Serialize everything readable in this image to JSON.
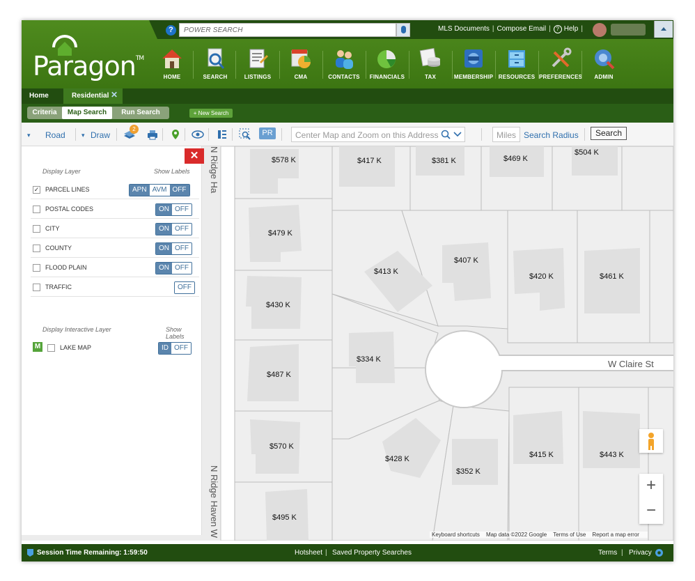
{
  "header": {
    "power_search_placeholder": "POWER SEARCH",
    "links": {
      "mls_documents": "MLS Documents",
      "compose_email": "Compose Email",
      "help": "Help"
    },
    "logo_text": "Paragon",
    "logo_tm": "TM",
    "nav": [
      {
        "label": "HOME",
        "icon": "home-icon"
      },
      {
        "label": "SEARCH",
        "icon": "search-icon"
      },
      {
        "label": "LISTINGS",
        "icon": "listings-icon"
      },
      {
        "label": "CMA",
        "icon": "cma-icon"
      },
      {
        "label": "CONTACTS",
        "icon": "contacts-icon"
      },
      {
        "label": "FINANCIALS",
        "icon": "financials-icon"
      },
      {
        "label": "TAX",
        "icon": "tax-icon"
      },
      {
        "label": "MEMBERSHIP",
        "icon": "membership-icon"
      },
      {
        "label": "RESOURCES",
        "icon": "resources-icon"
      },
      {
        "label": "PREFERENCES",
        "icon": "preferences-icon"
      },
      {
        "label": "ADMIN",
        "icon": "admin-icon"
      }
    ]
  },
  "tabs": {
    "home": "Home",
    "residential": "Residential",
    "close": "✕"
  },
  "subtabs": {
    "criteria": "Criteria",
    "map_search": "Map Search",
    "run_search": "Run Search",
    "new_search": "+ New Search"
  },
  "toolbar": {
    "road": "Road",
    "draw": "Draw",
    "layers_badge": "2",
    "pr": "PR",
    "address_placeholder": "Center Map and Zoom on this Address",
    "miles_placeholder": "Miles",
    "search_radius": "Search Radius",
    "search_button": "Search"
  },
  "layers": {
    "display_layer": "Display Layer",
    "show_labels": "Show Labels",
    "rows": [
      {
        "name": "PARCEL LINES",
        "checked": true,
        "options": [
          "APN",
          "AVM",
          "OFF"
        ]
      },
      {
        "name": "POSTAL CODES",
        "checked": false,
        "options": [
          "ON",
          "OFF"
        ]
      },
      {
        "name": "CITY",
        "checked": false,
        "options": [
          "ON",
          "OFF"
        ]
      },
      {
        "name": "COUNTY",
        "checked": false,
        "options": [
          "ON",
          "OFF"
        ]
      },
      {
        "name": "FLOOD PLAIN",
        "checked": false,
        "options": [
          "ON",
          "OFF"
        ]
      },
      {
        "name": "TRAFFIC",
        "checked": false,
        "options": [
          "OFF"
        ]
      }
    ],
    "interactive_layer": "Display Interactive Layer",
    "interactive_show_labels": "Show Labels",
    "lake_badge": "M",
    "lake_map": "LAKE MAP",
    "lake_options": [
      "ID",
      "OFF"
    ]
  },
  "map": {
    "prices": [
      "$578 K",
      "$417 K",
      "$381 K",
      "$469 K",
      "$504 K",
      "$479 K",
      "$407 K",
      "$413 K",
      "$420 K",
      "$461 K",
      "$430 K",
      "$334 K",
      "$487 K",
      "$570 K",
      "$428 K",
      "$352 K",
      "$415 K",
      "$443 K",
      "$495 K"
    ],
    "street_w_claire": "W Claire St",
    "street_n_ridge_top": "N Ridge Ha",
    "street_n_ridge_bottom": "N Ridge Haven W",
    "attribution": [
      "Keyboard shortcuts",
      "Map data ©2022 Google",
      "Terms of Use",
      "Report a map error"
    ],
    "zoom_in": "+",
    "zoom_out": "−"
  },
  "footer": {
    "session": "Session Time Remaining: 1:59:50",
    "hotsheet": "Hotsheet",
    "saved": "Saved Property Searches",
    "terms": "Terms",
    "privacy": "Privacy"
  },
  "colors": {
    "brand_green": "#3c7512",
    "dark_green": "#224d10",
    "accent_blue": "#2f6fad"
  }
}
